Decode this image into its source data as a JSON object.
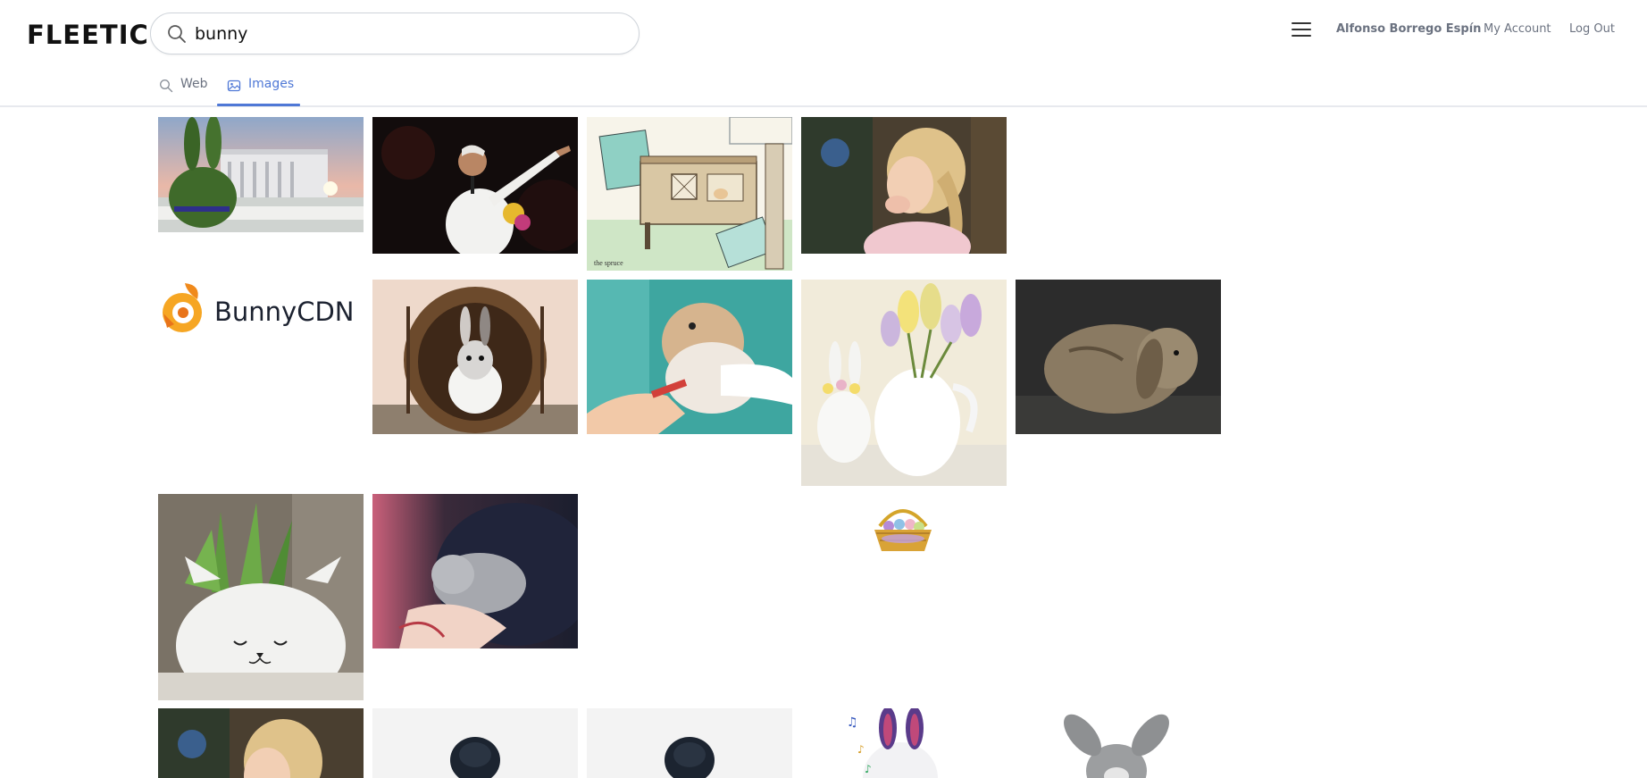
{
  "app": {
    "logo": "FLEETIC"
  },
  "search": {
    "query": "bunny"
  },
  "header": {
    "user_name": "Alfonso Borrego Espín",
    "my_account": "My Account",
    "log_out": "Log Out"
  },
  "tabs": [
    {
      "label": "Web",
      "icon": "search-icon",
      "active": false
    },
    {
      "label": "Images",
      "icon": "image-icon",
      "active": true
    }
  ],
  "colors": {
    "accent": "#4f78d6",
    "text_muted": "#6b7280"
  },
  "results": {
    "bunnycdn_logo_text": "BunnyCDN"
  }
}
